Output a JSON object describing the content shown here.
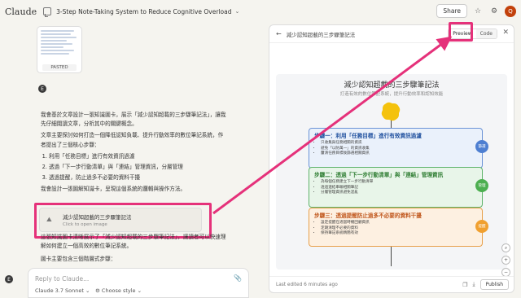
{
  "app": {
    "brand": "Claude"
  },
  "header": {
    "chat_title": "3-Step Note-Taking System to Reduce Cognitive Overload",
    "share_label": "Share",
    "avatar_initial": "Q"
  },
  "pasted": {
    "label": "PASTED"
  },
  "user": {
    "initial": "E"
  },
  "message": {
    "p1": "我會基於文章設計一張知識圖卡，展示「減少認知超載的三步驟筆記法」，讓我先仔細閱讀文章，分析其中的關鍵概念。",
    "p2": "文章主要探討如何打造一個降低認知負載、提升行動效率的數位筆記系統，作者提出了三個核心步驟：",
    "steps": [
      "利用「任務目標」進行有效資訊過濾",
      "透過「下一步行動清單」與「連結」管理資訊，分層管理",
      "透過提醒，防止過多不必要的資料干擾"
    ],
    "p3": "我會設計一張圖解知識卡，呈現這個系統的邏輯與操作方法。"
  },
  "attachment": {
    "title": "減少認知超載的三步驟筆記法",
    "subtitle": "Click to open image"
  },
  "message2": {
    "p1": "這張知識圖卡清晰展示了「減少認知超載的三步驟筆記法」，讓讀者可以快速理解如何建立一個高效的數位筆記系統。",
    "p2": "圖卡主要包含三個階層式步驟："
  },
  "input": {
    "placeholder": "Reply to Claude...",
    "model": "Claude 3.7 Sonnet",
    "style": "Choose style"
  },
  "panel": {
    "title": "減少認知超載的三步驟筆記法",
    "preview_label": "Preview",
    "code_label": "Code",
    "edited": "Last edited 6 minutes ago",
    "publish": "Publish"
  },
  "infographic": {
    "title": "減少認知超載的三步驟筆記法",
    "subtitle": "打造有效的數位筆記系統，提升行動效率和認知效能",
    "steps": [
      {
        "heading": "步驟一：利用「任務目標」進行有效資訊過濾",
        "bullets": [
          "只收集與任務相關的資訊",
          "避免「以防萬一」的資訊收集",
          "釐清任務目標後篩選相關資訊"
        ],
        "badge": "篩選"
      },
      {
        "heading": "步驟二：透過「下一步行動清單」與「連結」管理資訊",
        "bullets": [
          "為每個任務建立下一步行動清單",
          "透過連結串聯相關筆記",
          "分層管理資訊避免混亂"
        ],
        "badge": "管理"
      },
      {
        "heading": "步驟三：透過提醒防止過多不必要的資料干擾",
        "bullets": [
          "設定提醒在適當時機回顧資訊",
          "定期清理不必要的資料",
          "保持筆記系統精簡有效"
        ],
        "badge": "提醒"
      }
    ]
  },
  "colors": {
    "accent": "#e5317a",
    "avatar": "#c2410c",
    "step1": "#4e7fd1",
    "step2": "#4caf50",
    "step3": "#f0a030"
  }
}
